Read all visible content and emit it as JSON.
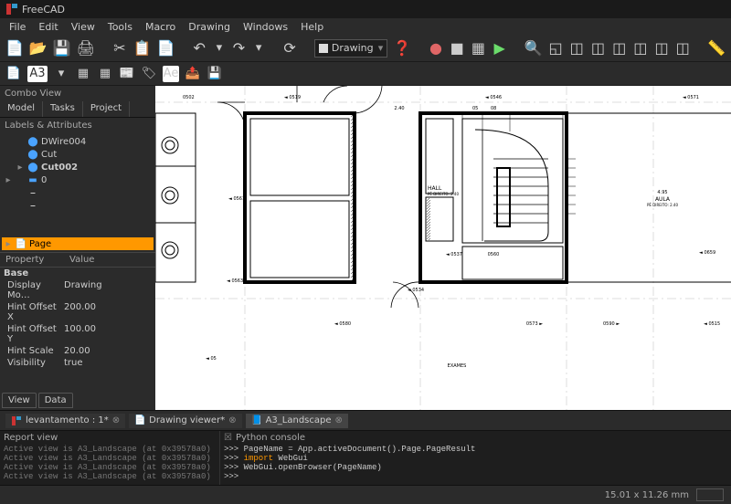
{
  "title": "FreeCAD",
  "menu": {
    "file": "File",
    "edit": "Edit",
    "view": "View",
    "tools": "Tools",
    "macro": "Macro",
    "drawing": "Drawing",
    "windows": "Windows",
    "help": "Help"
  },
  "workbench": {
    "label": "Drawing"
  },
  "combo": {
    "title": "Combo View",
    "tabs": {
      "model": "Model",
      "tasks": "Tasks",
      "project": "Project"
    },
    "labels_title": "Labels & Attributes"
  },
  "tree": {
    "items": [
      {
        "label": "DWire004",
        "selected": false
      },
      {
        "label": "Cut",
        "selected": false
      },
      {
        "label": "Cut002",
        "selected": false,
        "bold": true
      },
      {
        "label": "0",
        "selected": false
      },
      {
        "label": "",
        "selected": false
      },
      {
        "label": "",
        "selected": false
      },
      {
        "label": "Page",
        "selected": true
      }
    ]
  },
  "props": {
    "header": {
      "property": "Property",
      "value": "Value"
    },
    "rows": [
      {
        "cat": true,
        "name": "Base",
        "value": ""
      },
      {
        "name": "Display Mo…",
        "value": "Drawing"
      },
      {
        "name": "Hint Offset X",
        "value": "200.00"
      },
      {
        "name": "Hint Offset Y",
        "value": "100.00"
      },
      {
        "name": "Hint Scale",
        "value": "20.00"
      },
      {
        "name": "Visibility",
        "value": "true"
      }
    ]
  },
  "bottomtabs": {
    "view": "View",
    "data": "Data"
  },
  "doctabs": {
    "items": [
      {
        "label": "levantamento : 1*",
        "color": "red"
      },
      {
        "label": "Drawing viewer*",
        "color": "white"
      },
      {
        "label": "A3_Landscape",
        "color": "blue"
      }
    ]
  },
  "reportview": {
    "title": "Report view",
    "lines": [
      "Active view is A3_Landscape (at 0x39578a0)",
      "Active view is A3_Landscape (at 0x39578a0)",
      "Active view is A3_Landscape (at 0x39578a0)",
      "Active view is A3_Landscape (at 0x39578a0)"
    ]
  },
  "pyconsole": {
    "title": "Python console",
    "lines": [
      {
        "prompt": ">>>",
        "text": " PageName = App.activeDocument().Page.PageResult"
      },
      {
        "prompt": ">>>",
        "kw": "import",
        "text": " WebGui"
      },
      {
        "prompt": ">>>",
        "text": " WebGui.openBrowser(PageName)"
      },
      {
        "prompt": ">>>",
        "text": ""
      }
    ]
  },
  "statusbar": {
    "coords": "15.01 x 11.26 mm"
  },
  "drawing": {
    "labels": {
      "exames": "EXAMES",
      "hall": "HALL",
      "hall_sub": "PÉ DIREITO: 2.40",
      "aula": "AULA",
      "aula_sub": "PÉ DIREITO: 2.40",
      "dim240": "2.40",
      "dim495": "4.95"
    },
    "dims": [
      "0502",
      "0519",
      "0546",
      "0571",
      "0534",
      "0580",
      "0561",
      "0563",
      "0659",
      "0537",
      "0560",
      "0573",
      "0590",
      "0515",
      "05",
      "08"
    ]
  }
}
